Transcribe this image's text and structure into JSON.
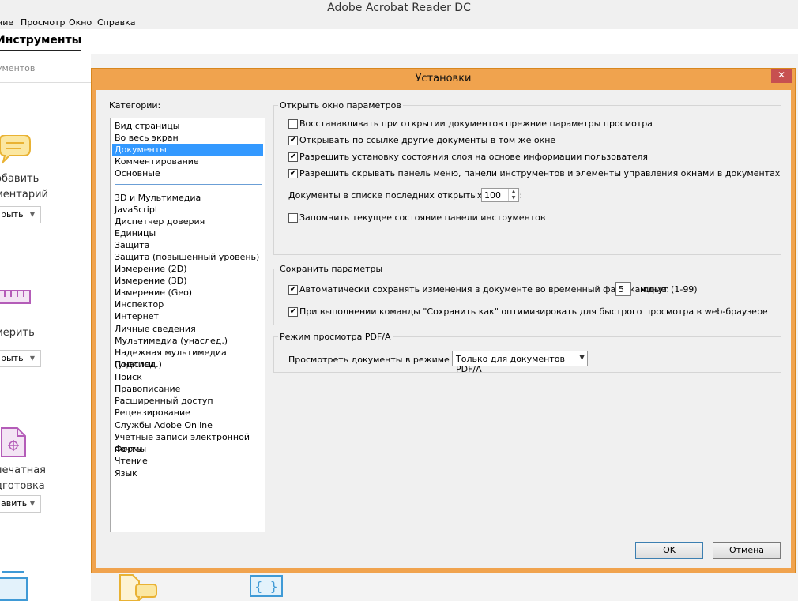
{
  "app": {
    "title": "Adobe Acrobat Reader DC",
    "menu": [
      "ние",
      "Просмотр",
      "Окно",
      "Справка"
    ],
    "tools_tab": "Инструменты",
    "search_hint": "ументов",
    "tools": [
      {
        "label1": "обавить",
        "label2": "ментарий",
        "button": "рыть"
      },
      {
        "label1": "мерить",
        "label2": "",
        "button": "рыть"
      },
      {
        "label1": "печатная",
        "label2": "дготовка",
        "button": "авить"
      }
    ]
  },
  "dialog": {
    "title": "Установки",
    "close": "✕",
    "categories_label": "Категории:",
    "categories_top": [
      "Вид страницы",
      "Во весь экран",
      "Документы",
      "Комментирование",
      "Основные"
    ],
    "categories_bottom": [
      "3D и Мультимедиа",
      "JavaScript",
      "Диспетчер доверия",
      "Единицы",
      "Защита",
      "Защита (повышенный уровень)",
      "Измерение (2D)",
      "Измерение (3D)",
      "Измерение (Geo)",
      "Инспектор",
      "Интернет",
      "Личные сведения",
      "Мультимедиа (унаслед.)",
      "Надежная мультимедиа (унаслед.)",
      "Подписи",
      "Поиск",
      "Правописание",
      "Расширенный доступ",
      "Рецензирование",
      "Службы Adobe Online",
      "Учетные записи электронной почты",
      "Формы",
      "Чтение",
      "Язык"
    ],
    "selected_category": "Документы",
    "open_group": {
      "title": "Открыть окно параметров",
      "options": [
        {
          "label": "Восстанавливать при открытии документов прежние параметры просмотра",
          "checked": false
        },
        {
          "label": "Открывать по ссылке другие документы в том же окне",
          "checked": true
        },
        {
          "label": "Разрешить установку состояния слоя на основе информации пользователя",
          "checked": true
        },
        {
          "label": "Разрешить скрывать панель меню, панели инструментов и элементы управления окнами в документах",
          "checked": true
        }
      ],
      "recent_label": "Документы в списке последних открытых файлов:",
      "recent_value": "100",
      "remember_toolbar": {
        "label": "Запомнить текущее состояние панели инструментов",
        "checked": false
      }
    },
    "save_group": {
      "title": "Сохранить параметры",
      "autosave": {
        "label": "Автоматически сохранять изменения в документе во временный файл каждые:",
        "checked": true
      },
      "autosave_value": "5",
      "autosave_unit": "минут (1-99)",
      "optimize": {
        "label": "При выполнении команды \"Сохранить как\" оптимизировать для быстрого просмотра в web-браузере",
        "checked": true
      }
    },
    "pdfa_group": {
      "title": "Режим просмотра PDF/A",
      "label": "Просмотреть документы в режиме PDF/A:",
      "value": "Только для документов PDF/A"
    },
    "ok": "OK",
    "cancel": "Отмена",
    "check_mark": "✔"
  }
}
